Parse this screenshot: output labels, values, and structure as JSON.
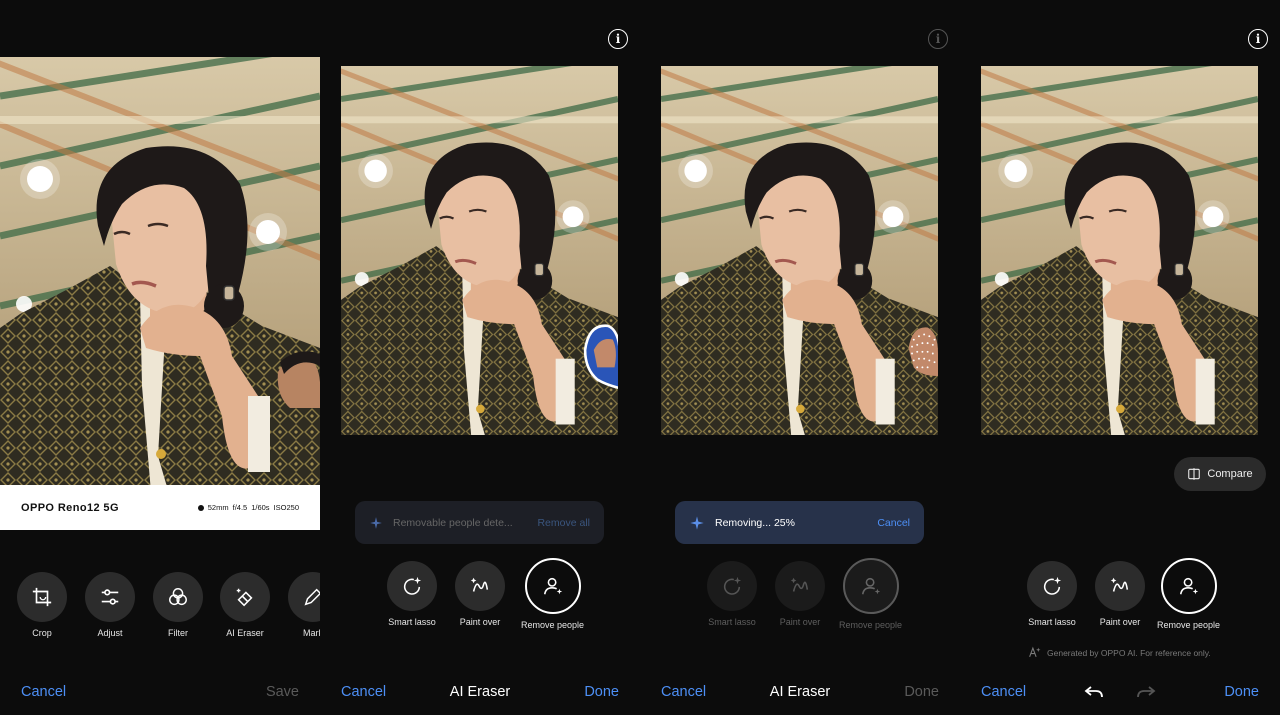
{
  "panel1": {
    "watermark": {
      "model": "OPPO Reno12 5G",
      "specs": [
        "52mm",
        "f/4.5",
        "1/60s",
        "ISO250"
      ]
    },
    "tools": [
      {
        "label": "Crop",
        "icon": "crop-icon"
      },
      {
        "label": "Adjust",
        "icon": "sliders-icon"
      },
      {
        "label": "Filter",
        "icon": "filter-icon"
      },
      {
        "label": "AI Eraser",
        "icon": "eraser-icon"
      },
      {
        "label": "Mark",
        "icon": "pen-icon"
      }
    ],
    "cancel_label": "Cancel",
    "save_label": "Save"
  },
  "panel2": {
    "banner": {
      "text": "Removable people dete...",
      "action": "Remove all"
    },
    "title": "AI Eraser",
    "cancel_label": "Cancel",
    "done_label": "Done"
  },
  "panel3": {
    "banner": {
      "text": "Removing... 25%",
      "action": "Cancel",
      "progress_percent": 25
    },
    "title": "AI Eraser",
    "cancel_label": "Cancel",
    "done_label": "Done"
  },
  "panel4": {
    "compare_label": "Compare",
    "disclaimer": "Generated by OPPO AI. For reference only.",
    "cancel_label": "Cancel",
    "done_label": "Done"
  },
  "eraser_tools": [
    {
      "label": "Smart lasso",
      "icon": "smart-lasso-icon"
    },
    {
      "label": "Paint over",
      "icon": "paint-over-icon"
    },
    {
      "label": "Remove people",
      "icon": "remove-people-icon"
    }
  ],
  "colors": {
    "accent": "#4d8ff5",
    "background": "#0c0c0c",
    "tool_bg": "#2c2c2c"
  }
}
